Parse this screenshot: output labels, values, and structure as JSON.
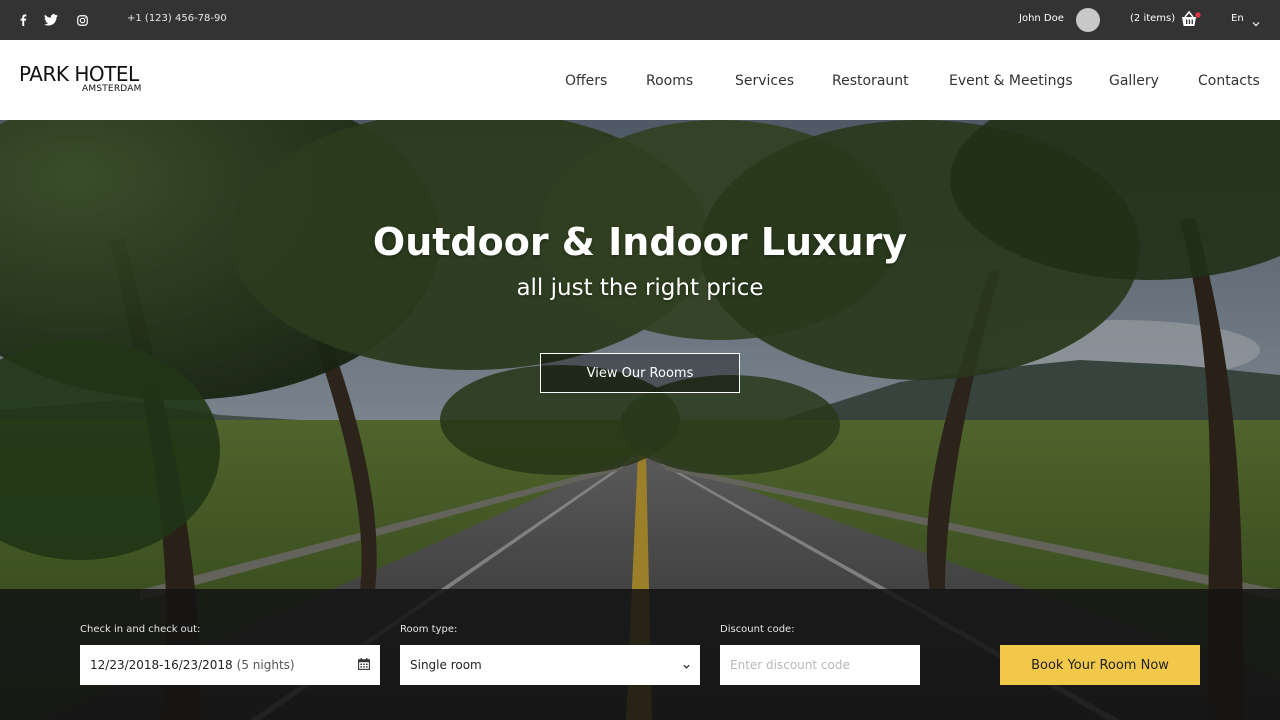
{
  "topbar": {
    "social": [
      {
        "icon": "facebook-icon"
      },
      {
        "icon": "twitter-icon"
      },
      {
        "icon": "instagram-icon"
      }
    ],
    "phone": "+1 (123) 456-78-90",
    "user_name": "John Doe",
    "cart_label": "(2 items)",
    "language": "En"
  },
  "header": {
    "logo_line1": "PARK HOTEL",
    "logo_line2": "AMSTERDAM",
    "nav": [
      "Offers",
      "Rooms",
      "Services",
      "Restoraunt",
      "Event & Meetings",
      "Gallery",
      "Contacts"
    ]
  },
  "hero": {
    "title": "Outdoor & Indoor Luxury",
    "subtitle": "all just the right price",
    "button": "View Our Rooms"
  },
  "booking": {
    "dates_label": "Check in and check out:",
    "dates_value": "12/23/2018-16/23/2018",
    "nights": "(5 nights)",
    "room_label": "Room type:",
    "room_value": "Single room",
    "discount_label": "Discount code:",
    "discount_placeholder": "Enter discount code",
    "book_button": "Book Your Room Now"
  },
  "colors": {
    "topbar_bg": "#333333",
    "accent_yellow": "#f2c84b",
    "cart_badge": "#e0393e"
  }
}
